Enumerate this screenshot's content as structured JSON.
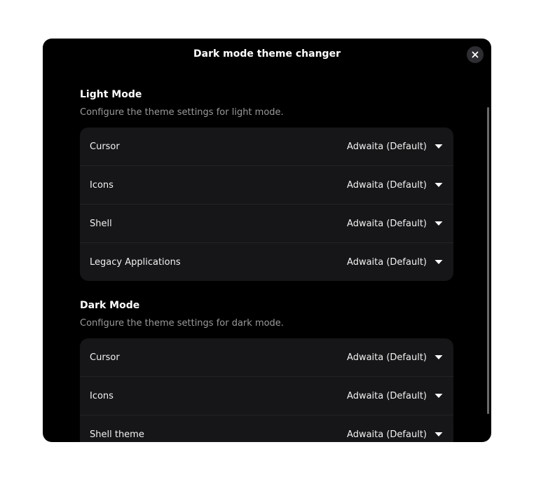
{
  "dialog": {
    "title": "Dark mode theme changer"
  },
  "light_mode": {
    "title": "Light Mode",
    "description": "Configure the theme settings for light mode.",
    "rows": [
      {
        "label": "Cursor",
        "value": "Adwaita (Default)"
      },
      {
        "label": "Icons",
        "value": "Adwaita (Default)"
      },
      {
        "label": "Shell",
        "value": "Adwaita (Default)"
      },
      {
        "label": "Legacy Applications",
        "value": "Adwaita (Default)"
      }
    ]
  },
  "dark_mode": {
    "title": "Dark Mode",
    "description": "Configure the theme settings for dark mode.",
    "rows": [
      {
        "label": "Cursor",
        "value": "Adwaita (Default)"
      },
      {
        "label": "Icons",
        "value": "Adwaita (Default)"
      },
      {
        "label": "Shell theme",
        "value": "Adwaita (Default)"
      }
    ]
  },
  "icons": {
    "close": "close-icon",
    "dropdown": "pan-down-icon"
  },
  "colors": {
    "dialog_bg": "#000000",
    "row_bg": "#161618",
    "text": "#ffffff",
    "muted_text": "#9a9a9a"
  }
}
